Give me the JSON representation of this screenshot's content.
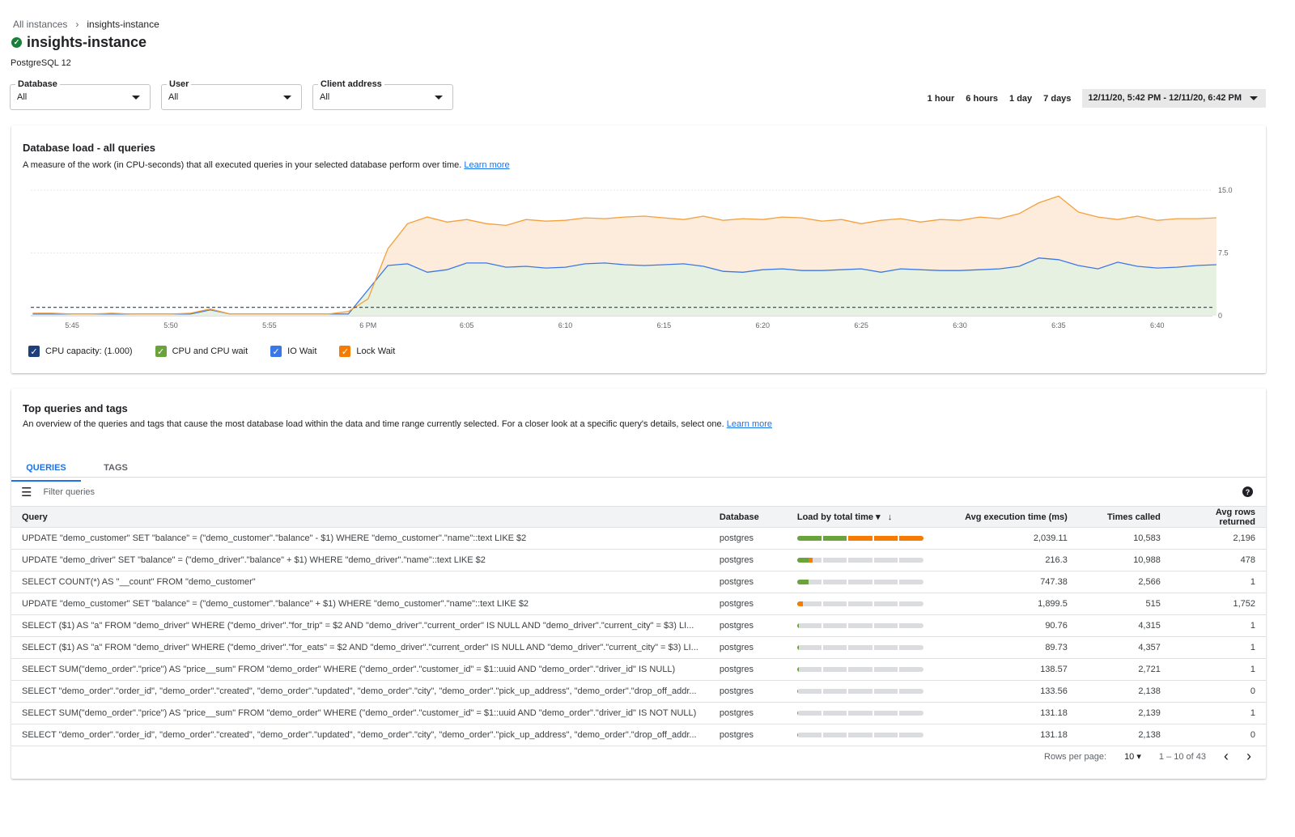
{
  "breadcrumb": {
    "parent": "All instances",
    "current": "insights-instance"
  },
  "header": {
    "title": "insights-instance",
    "status_icon": "check-circle-icon",
    "subtitle": "PostgreSQL 12"
  },
  "filters": [
    {
      "label": "Database",
      "value": "All"
    },
    {
      "label": "User",
      "value": "All"
    },
    {
      "label": "Client address",
      "value": "All"
    }
  ],
  "time_ranges": {
    "options": [
      "1 hour",
      "6 hours",
      "1 day",
      "7 days"
    ],
    "selected_range": "12/11/20, 5:42 PM - 12/11/20, 6:42 PM"
  },
  "load_card": {
    "title": "Database load - all queries",
    "description": "A measure of the work (in CPU-seconds) that all executed queries in your selected database perform over time.",
    "learn_more": "Learn more"
  },
  "chart_data": {
    "type": "area",
    "x_ticks": [
      "5:45",
      "5:50",
      "5:55",
      "6 PM",
      "6:05",
      "6:10",
      "6:15",
      "6:20",
      "6:25",
      "6:30",
      "6:35",
      "6:40"
    ],
    "y_ticks": [
      "0",
      "7.5",
      "15.0"
    ],
    "ylim": [
      0,
      15
    ],
    "grid": true,
    "x": [
      "5:43",
      "5:44",
      "5:45",
      "5:46",
      "5:47",
      "5:48",
      "5:49",
      "5:50",
      "5:51",
      "5:52",
      "5:53",
      "5:54",
      "5:55",
      "5:56",
      "5:57",
      "5:58",
      "5:59",
      "6:00",
      "6:01",
      "6:02",
      "6:03",
      "6:04",
      "6:05",
      "6:06",
      "6:07",
      "6:08",
      "6:09",
      "6:10",
      "6:11",
      "6:12",
      "6:13",
      "6:14",
      "6:15",
      "6:16",
      "6:17",
      "6:18",
      "6:19",
      "6:20",
      "6:21",
      "6:22",
      "6:23",
      "6:24",
      "6:25",
      "6:26",
      "6:27",
      "6:28",
      "6:29",
      "6:30",
      "6:31",
      "6:32",
      "6:33",
      "6:34",
      "6:35",
      "6:36",
      "6:37",
      "6:38",
      "6:39",
      "6:40",
      "6:41",
      "6:42",
      "6:43"
    ],
    "series": [
      {
        "name": "CPU capacity: (1.000)",
        "color": "#1f3f7a",
        "style": "dashed",
        "constant": 1.0
      },
      {
        "name": "IO Wait",
        "color": "#3b78e7",
        "values": [
          0.2,
          0.2,
          0.2,
          0.2,
          0.2,
          0.2,
          0.2,
          0.2,
          0.2,
          0.7,
          0.2,
          0.2,
          0.2,
          0.2,
          0.2,
          0.2,
          0.2,
          3.1,
          6.0,
          6.2,
          5.2,
          5.5,
          6.3,
          6.3,
          5.8,
          5.9,
          5.7,
          5.8,
          6.2,
          6.3,
          6.1,
          6.0,
          6.1,
          6.2,
          5.9,
          5.3,
          5.2,
          5.5,
          5.6,
          5.4,
          5.4,
          5.5,
          5.6,
          5.2,
          5.6,
          5.5,
          5.4,
          5.4,
          5.5,
          5.6,
          5.9,
          6.9,
          6.7,
          6.0,
          5.6,
          6.4,
          5.9,
          5.7,
          5.8,
          6.0,
          6.1
        ]
      },
      {
        "name": "Lock Wait",
        "color": "#f4a03c",
        "values": [
          0.3,
          0.3,
          0.2,
          0.2,
          0.3,
          0.2,
          0.2,
          0.2,
          0.3,
          0.8,
          0.2,
          0.2,
          0.2,
          0.2,
          0.2,
          0.2,
          0.5,
          2.0,
          8.0,
          11.0,
          11.8,
          11.2,
          11.5,
          11.0,
          10.8,
          11.5,
          11.3,
          11.4,
          11.7,
          11.6,
          11.8,
          11.9,
          11.7,
          11.5,
          11.9,
          11.4,
          11.6,
          11.5,
          11.8,
          11.7,
          11.3,
          11.5,
          11.0,
          11.4,
          11.6,
          11.2,
          11.5,
          11.4,
          11.8,
          11.6,
          12.2,
          13.5,
          14.3,
          12.4,
          11.8,
          11.5,
          11.9,
          11.4,
          11.6,
          11.6,
          11.7
        ]
      }
    ],
    "legend": [
      {
        "label": "CPU capacity: (1.000)",
        "color": "#1f3f7a",
        "checked": true
      },
      {
        "label": "CPU and CPU wait",
        "color": "#6aa33c",
        "checked": true
      },
      {
        "label": "IO Wait",
        "color": "#3b78e7",
        "checked": true
      },
      {
        "label": "Lock Wait",
        "color": "#f57c00",
        "checked": true
      }
    ],
    "legend_position": "bottom-left"
  },
  "queries_card": {
    "title": "Top queries and tags",
    "description": "An overview of the queries and tags that cause the most database load within the data and time range currently selected. For a closer look at a specific query's details, select one.",
    "learn_more": "Learn more",
    "tabs": [
      "QUERIES",
      "TAGS"
    ],
    "active_tab": "QUERIES",
    "filter_placeholder": "Filter queries",
    "columns": [
      "Query",
      "Database",
      "Load by total time",
      "Avg execution time (ms)",
      "Times called",
      "Avg rows returned"
    ],
    "rows": [
      {
        "query": "UPDATE \"demo_customer\" SET \"balance\" = (\"demo_customer\".\"balance\" - $1) WHERE \"demo_customer\".\"name\"::text LIKE $2",
        "db": "postgres",
        "cpu": 0.4,
        "lock": 0.6,
        "avg": "2,039.11",
        "calls": "10,583",
        "rows": "2,196"
      },
      {
        "query": "UPDATE \"demo_driver\" SET \"balance\" = (\"demo_driver\".\"balance\" + $1) WHERE \"demo_driver\".\"name\"::text LIKE $2",
        "db": "postgres",
        "cpu": 0.09,
        "lock": 0.03,
        "avg": "216.3",
        "calls": "10,988",
        "rows": "478"
      },
      {
        "query": "SELECT COUNT(*) AS \"__count\" FROM \"demo_customer\"",
        "db": "postgres",
        "cpu": 0.09,
        "lock": 0,
        "avg": "747.38",
        "calls": "2,566",
        "rows": "1"
      },
      {
        "query": "UPDATE \"demo_customer\" SET \"balance\" = (\"demo_customer\".\"balance\" + $1) WHERE \"demo_customer\".\"name\"::text LIKE $2",
        "db": "postgres",
        "cpu": 0.01,
        "lock": 0.035,
        "avg": "1,899.5",
        "calls": "515",
        "rows": "1,752"
      },
      {
        "query": "SELECT ($1) AS \"a\" FROM \"demo_driver\" WHERE (\"demo_driver\".\"for_trip\" = $2 AND \"demo_driver\".\"current_order\" IS NULL AND \"demo_driver\".\"current_city\" = $3) LI...",
        "db": "postgres",
        "cpu": 0.012,
        "lock": 0,
        "avg": "90.76",
        "calls": "4,315",
        "rows": "1"
      },
      {
        "query": "SELECT ($1) AS \"a\" FROM \"demo_driver\" WHERE (\"demo_driver\".\"for_eats\" = $2 AND \"demo_driver\".\"current_order\" IS NULL AND \"demo_driver\".\"current_city\" = $3) LI...",
        "db": "postgres",
        "cpu": 0.012,
        "lock": 0,
        "avg": "89.73",
        "calls": "4,357",
        "rows": "1"
      },
      {
        "query": "SELECT SUM(\"demo_order\".\"price\") AS \"price__sum\" FROM \"demo_order\" WHERE (\"demo_order\".\"customer_id\" = $1::uuid AND \"demo_order\".\"driver_id\" IS NULL)",
        "db": "postgres",
        "cpu": 0.012,
        "lock": 0,
        "avg": "138.57",
        "calls": "2,721",
        "rows": "1"
      },
      {
        "query": "SELECT \"demo_order\".\"order_id\", \"demo_order\".\"created\", \"demo_order\".\"updated\", \"demo_order\".\"city\", \"demo_order\".\"pick_up_address\", \"demo_order\".\"drop_off_addr...",
        "db": "postgres",
        "cpu": 0.01,
        "lock": 0,
        "avg": "133.56",
        "calls": "2,138",
        "rows": "0"
      },
      {
        "query": "SELECT SUM(\"demo_order\".\"price\") AS \"price__sum\" FROM \"demo_order\" WHERE (\"demo_order\".\"customer_id\" = $1::uuid AND \"demo_order\".\"driver_id\" IS NOT NULL)",
        "db": "postgres",
        "cpu": 0.01,
        "lock": 0,
        "avg": "131.18",
        "calls": "2,139",
        "rows": "1"
      },
      {
        "query": "SELECT \"demo_order\".\"order_id\", \"demo_order\".\"created\", \"demo_order\".\"updated\", \"demo_order\".\"city\", \"demo_order\".\"pick_up_address\", \"demo_order\".\"drop_off_addr...",
        "db": "postgres",
        "cpu": 0.01,
        "lock": 0,
        "avg": "131.18",
        "calls": "2,138",
        "rows": "0"
      }
    ],
    "pagination": {
      "rows_per_page_label": "Rows per page:",
      "rows_per_page": "10",
      "range": "1 – 10 of 43"
    }
  }
}
